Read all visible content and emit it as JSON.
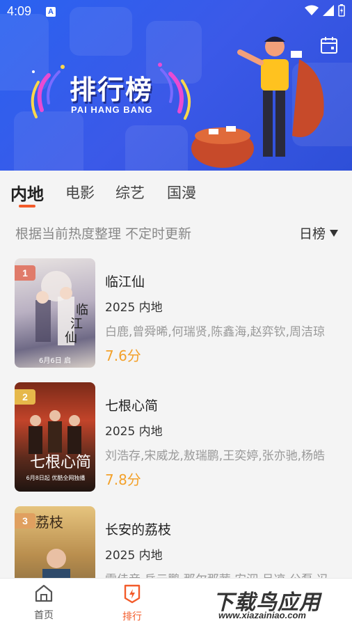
{
  "status_bar": {
    "time": "4:09",
    "notification_badge": "A"
  },
  "banner": {
    "title": "排行榜",
    "subtitle": "PAI HANG BANG",
    "colors": {
      "background": "#2a62f0"
    }
  },
  "tabs": [
    {
      "label": "内地",
      "active": true
    },
    {
      "label": "电影",
      "active": false
    },
    {
      "label": "综艺",
      "active": false
    },
    {
      "label": "国漫",
      "active": false
    }
  ],
  "subbar": {
    "description": "根据当前热度整理 不定时更新",
    "period": "日榜"
  },
  "list": [
    {
      "rank": "1",
      "title": "临江仙",
      "meta": "2025  内地",
      "cast": "白鹿,曾舜晞,何瑞贤,陈鑫海,赵弈钦,周洁琼",
      "score": "7.6分",
      "poster_caption": "6月6日 启",
      "rank_color": "#e07b6a",
      "poster_colors": [
        "#d9d0d4",
        "#7f7490",
        "#e8e3df"
      ]
    },
    {
      "rank": "2",
      "title": "七根心简",
      "meta": "2025  内地",
      "cast": "刘浩存,宋威龙,敖瑞鹏,王奕婷,张亦驰,杨皓",
      "score": "7.8分",
      "poster_caption": "6月8日起 优酷全网独播",
      "rank_color": "#e6b84a",
      "poster_colors": [
        "#5a2c1c",
        "#c2442a",
        "#2a1a14"
      ]
    },
    {
      "rank": "3",
      "title": "长安的荔枝",
      "meta": "2025  内地",
      "cast": "雷佳音,岳云鹏,那尔那茜,安泅,吕凉,公磊,冯",
      "score": "",
      "poster_caption": "",
      "rank_color": "#e0a060",
      "poster_colors": [
        "#c79a58",
        "#6c5a3a",
        "#e9c98a"
      ]
    }
  ],
  "bottom_nav": [
    {
      "label": "首页",
      "icon": "home-icon",
      "active": false
    },
    {
      "label": "排行",
      "icon": "ranking-icon",
      "active": true
    }
  ],
  "watermark": {
    "title": "下载鸟应用",
    "url": "www.xiazainiao.com"
  },
  "colors": {
    "accent": "#f35b2a",
    "score": "#f3a12a"
  }
}
